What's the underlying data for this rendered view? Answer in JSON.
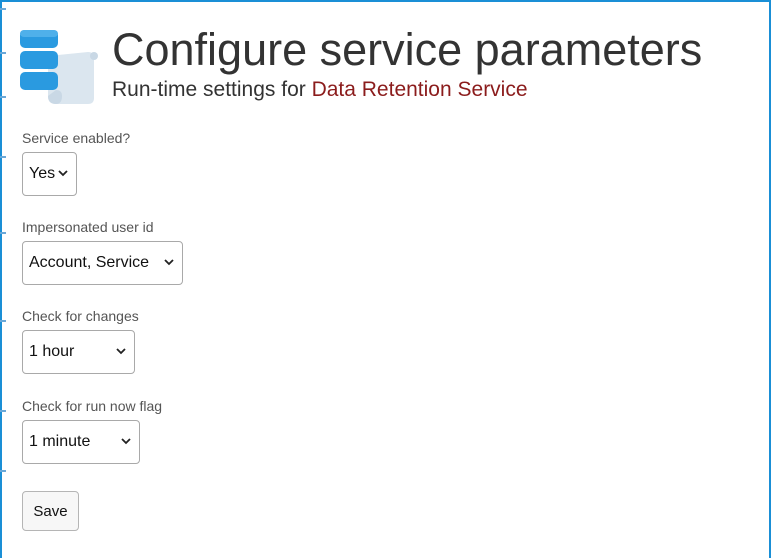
{
  "header": {
    "title": "Configure service parameters",
    "subtitle_prefix": "Run-time settings for ",
    "service_name": "Data Retention Service",
    "logo_icon": "database-scroll-icon",
    "colors": {
      "accent": "#1a8fd6",
      "service_name": "#8b1c1c",
      "logo_blue": "#2a9ae0",
      "logo_scroll": "#dbe6ef"
    }
  },
  "form": {
    "service_enabled": {
      "label": "Service enabled?",
      "value": "Yes"
    },
    "impersonated_user": {
      "label": "Impersonated user id",
      "value": "Account, Service"
    },
    "check_changes": {
      "label": "Check for changes",
      "value": "1 hour"
    },
    "check_run_now": {
      "label": "Check for run now flag",
      "value": "1 minute"
    },
    "save_label": "Save"
  }
}
